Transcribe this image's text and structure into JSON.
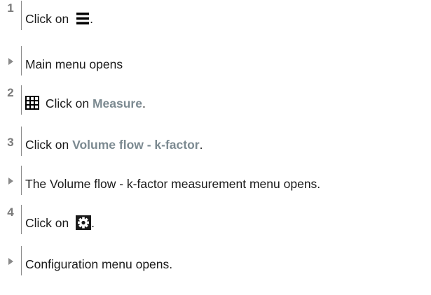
{
  "steps": [
    {
      "marker": "1",
      "prefix": "Click on ",
      "suffix": ".",
      "icon": "menu-icon"
    },
    {
      "marker": "▶",
      "text": "Main menu opens"
    },
    {
      "marker": "2",
      "icon": "grid-icon",
      "prefix": " Click on ",
      "highlight": "Measure",
      "suffix": "."
    },
    {
      "marker": "3",
      "prefix": "Click on ",
      "highlight": "Volume flow - k-factor",
      "suffix": "."
    },
    {
      "marker": "▶",
      "text": "The Volume flow - k-factor measurement menu opens."
    },
    {
      "marker": "4",
      "prefix": "Click on ",
      "suffix": ".",
      "icon": "gear-icon"
    },
    {
      "marker": "▶",
      "text": "Configuration menu opens."
    }
  ],
  "colors": {
    "text": "#1a1a1a",
    "highlight": "#7c8a91",
    "marker": "#7a7a7a",
    "icon_fill": "#000000"
  }
}
